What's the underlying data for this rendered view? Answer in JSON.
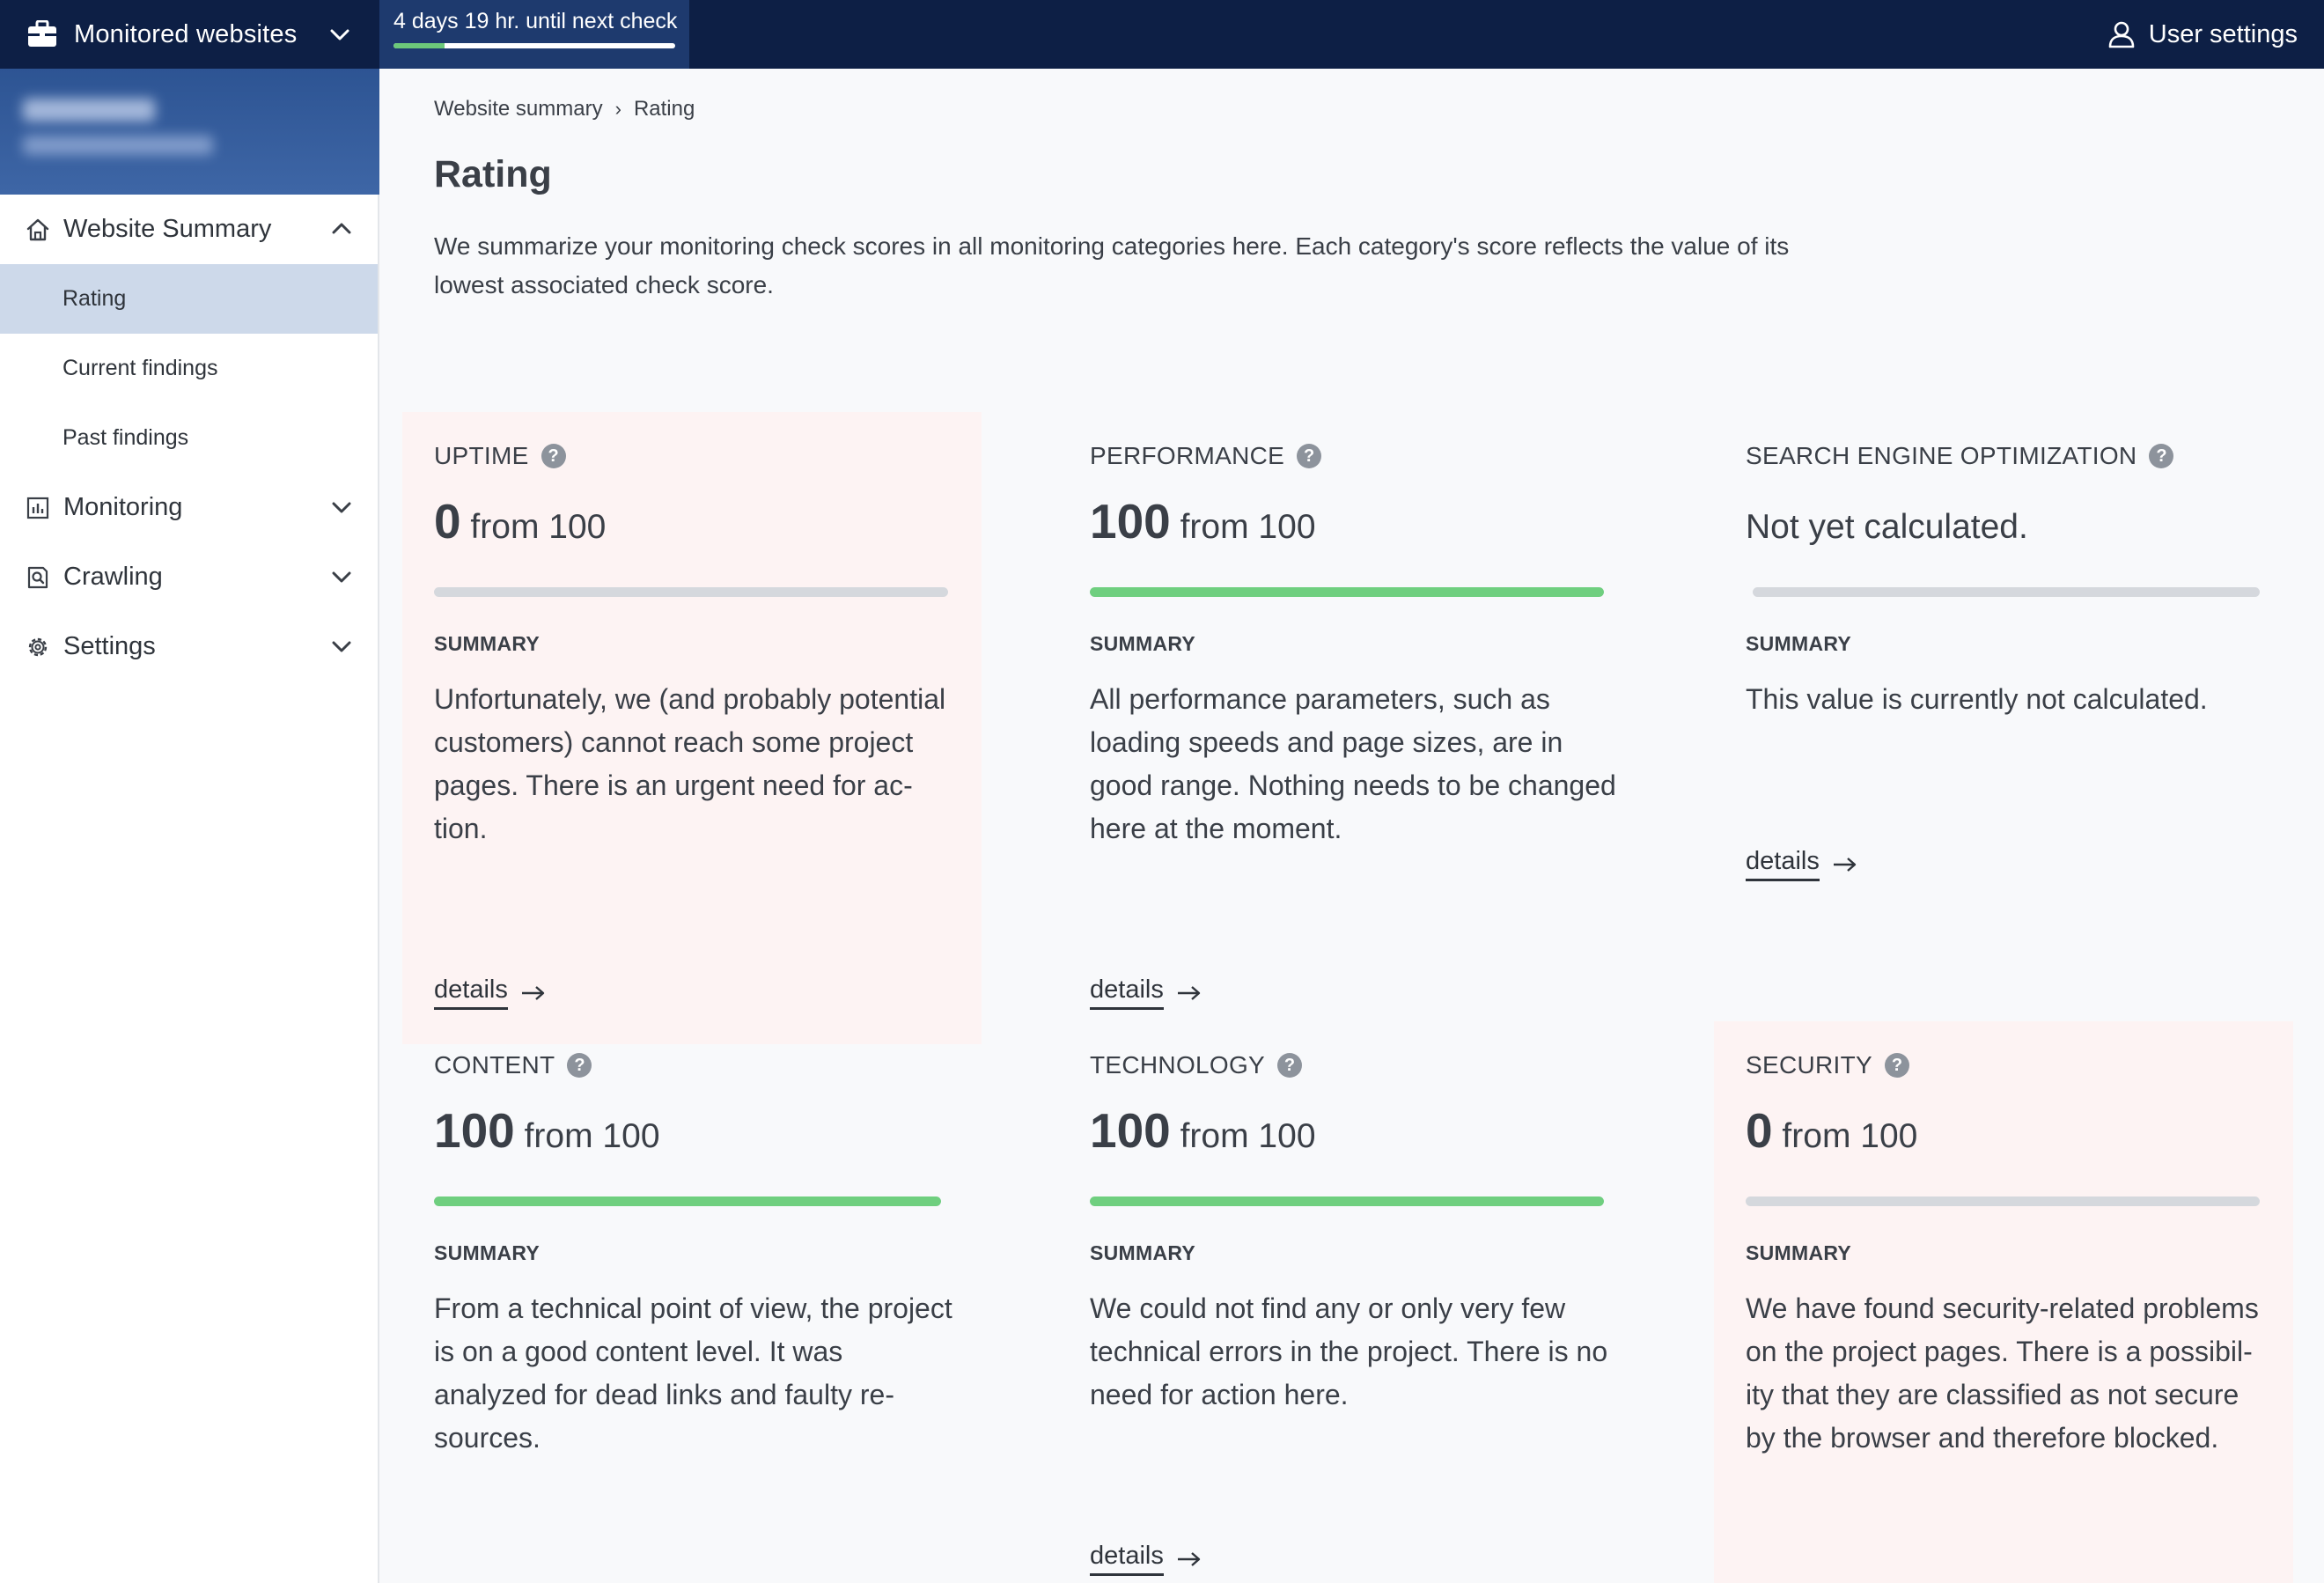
{
  "topbar": {
    "app_switch_label": "Monitored websites",
    "check_timer_text": "4 days 19 hr. until next check",
    "check_timer_progress_fraction": 0.18,
    "user_settings_label": "User settings",
    "background_color": "#0d1f45"
  },
  "sidebar": {
    "website_summary": {
      "label": "Website Summary",
      "items": [
        {
          "label": "Rating",
          "active": true
        },
        {
          "label": "Current findings",
          "active": false
        },
        {
          "label": "Past findings",
          "active": false
        }
      ]
    },
    "monitoring_label": "Monitoring",
    "crawling_label": "Crawling",
    "settings_label": "Settings"
  },
  "main": {
    "breadcrumb": {
      "parent": "Website summary",
      "separator": "›",
      "current": "Rating"
    },
    "title": "Rating",
    "description": "We summarize your monitoring check scores in all monitoring categories here. Each category's score reflects the value of its lowest associated check score.",
    "summary_label": "SUMMARY",
    "details_label": "details",
    "cards": [
      {
        "title": "UPTIME",
        "score": "0",
        "score_suffix": " from 100",
        "progress_fraction": 0.0,
        "alert": true,
        "summary": "Unfortunately, we (and probably potential customers) cannot reach some project pages. There is an urgent need for ac- tion."
      },
      {
        "title": "PERFORMANCE",
        "score": "100",
        "score_suffix": " from 100",
        "progress_fraction": 1.0,
        "alert": false,
        "summary": "All performance parameters, such as loading speeds and page sizes, are in good range. Nothing needs to be changed here at the moment."
      },
      {
        "title": "SEARCH ENGINE OPTIMIZATION",
        "score": "",
        "score_suffix": "Not yet calculated.",
        "progress_fraction": 0.0,
        "alert": false,
        "summary": "This value is currently not calculated."
      },
      {
        "title": "CONTENT",
        "score": "100",
        "score_suffix": " from 100",
        "progress_fraction": 1.0,
        "alert": false,
        "summary": "From a technical point of view, the project is on a good content level. It was analyzed for dead links and faulty re- sources."
      },
      {
        "title": "TECHNOLOGY",
        "score": "100",
        "score_suffix": " from 100",
        "progress_fraction": 1.0,
        "alert": false,
        "summary": "We could not find any or only very few technical errors in the project. There is no need for action here."
      },
      {
        "title": "SECURITY",
        "score": "0",
        "score_suffix": " from 100",
        "progress_fraction": 0.0,
        "alert": true,
        "summary": "We have found security-related problems on the project pages. There is a possibil- ity that they are classified as not secure by the browser and therefore blocked."
      }
    ]
  },
  "icons": {
    "app_switch": "briefcase-icon",
    "user": "user-icon",
    "website_summary": "home-icon",
    "monitoring": "chart-icon",
    "crawling": "search-page-icon",
    "settings": "gear-icon",
    "help": "help-circle-icon",
    "details": "arrow-right-icon"
  },
  "colors": {
    "alert_card_bg": "#fdf3f3",
    "progress_good": "#6fcf7f",
    "progress_track": "#d5d8dd",
    "active_nav": "#cdd9ea",
    "sidebar_header": "#2d5493"
  }
}
